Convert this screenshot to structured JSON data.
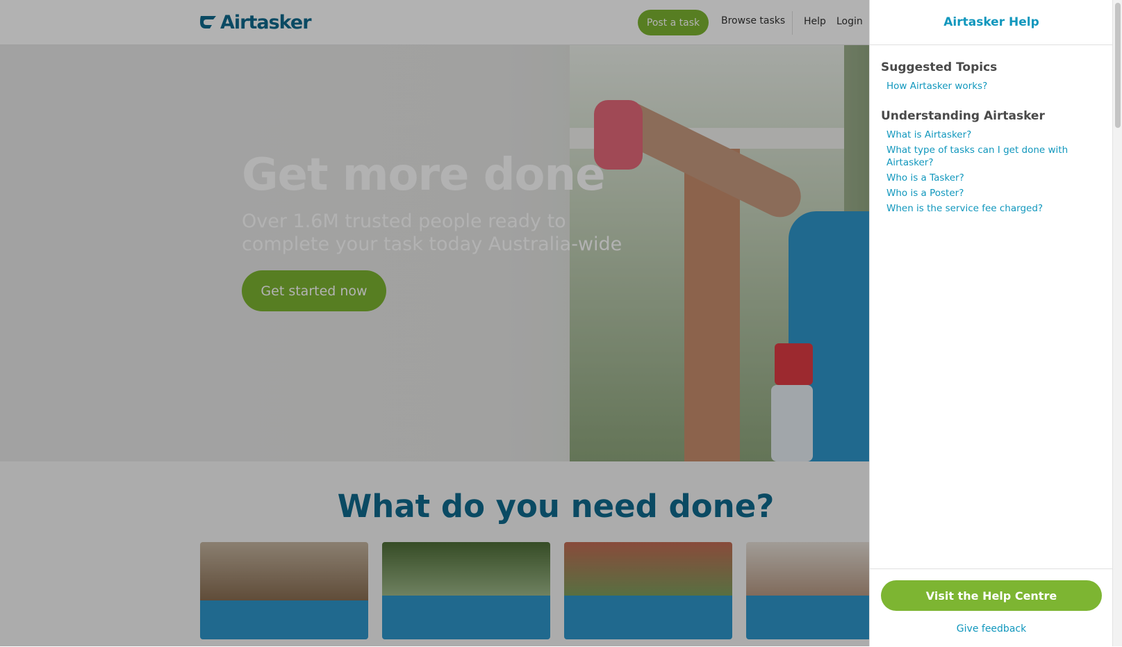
{
  "header": {
    "logo_text": "Airtasker",
    "post_task_label": "Post a task",
    "browse_tasks_label": "Browse tasks",
    "help_label": "Help",
    "login_label": "Login"
  },
  "hero": {
    "title": "Get more done",
    "subtitle": "Over 1.6M trusted people ready to complete your task today Australia-wide",
    "cta_label": "Get started now"
  },
  "section": {
    "title": "What do you need done?"
  },
  "help_panel": {
    "title": "Airtasker Help",
    "groups": [
      {
        "heading": "Suggested Topics",
        "items": [
          "How Airtasker works?"
        ]
      },
      {
        "heading": "Understanding Airtasker",
        "items": [
          "What is Airtasker?",
          "What type of tasks can I get done with Airtasker?",
          "Who is a Tasker?",
          "Who is a Poster?",
          "When is the service fee charged?"
        ]
      }
    ],
    "visit_label": "Visit the Help Centre",
    "feedback_label": "Give feedback"
  },
  "colors": {
    "brand_blue": "#1197bd",
    "brand_green": "#7db532",
    "logo_navy": "#0f6b8e"
  }
}
